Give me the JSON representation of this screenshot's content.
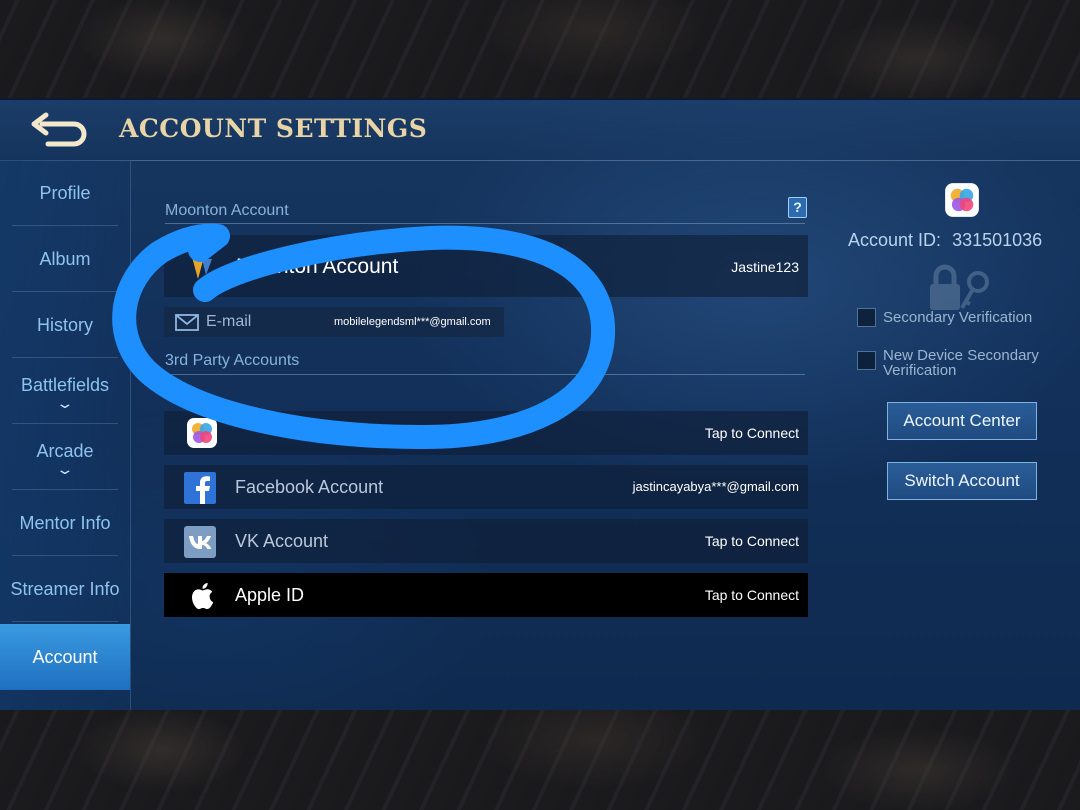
{
  "header": {
    "title": "ACCOUNT SETTINGS"
  },
  "sidebar": {
    "items": [
      {
        "label": "Profile"
      },
      {
        "label": "Album"
      },
      {
        "label": "History"
      },
      {
        "label": "Battlefields",
        "expandable": true
      },
      {
        "label": "Arcade",
        "expandable": true
      },
      {
        "label": "Mentor Info"
      },
      {
        "label": "Streamer Info"
      },
      {
        "label": "Account",
        "active": true
      }
    ]
  },
  "moonton": {
    "section_label": "Moonton Account",
    "help_label": "?",
    "account_label": "Moonton Account",
    "username": "Jastine123",
    "email_label": "E-mail",
    "email_value": "mobilelegendsml***@gmail.com"
  },
  "third_party": {
    "section_label": "3rd Party Accounts",
    "rows": [
      {
        "label": "",
        "value": "Tap to Connect",
        "icon": "game-center-icon"
      },
      {
        "label": "Facebook Account",
        "value": "jastincayabya***@gmail.com",
        "icon": "facebook-icon"
      },
      {
        "label": "VK Account",
        "value": "Tap to Connect",
        "icon": "vk-icon"
      },
      {
        "label": "Apple ID",
        "value": "Tap to Connect",
        "icon": "apple-icon"
      }
    ]
  },
  "right_panel": {
    "account_id_label": "Account ID:",
    "account_id": "331501036",
    "secondary_verification": "Secondary Verification",
    "new_device_line1": "New Device Secondary",
    "new_device_line2": "Verification",
    "account_center_button": "Account Center",
    "switch_account_button": "Switch Account"
  },
  "colors": {
    "accent": "#2b8de0",
    "title": "#e9d4a6",
    "annotation_stroke": "#1e8fff"
  }
}
